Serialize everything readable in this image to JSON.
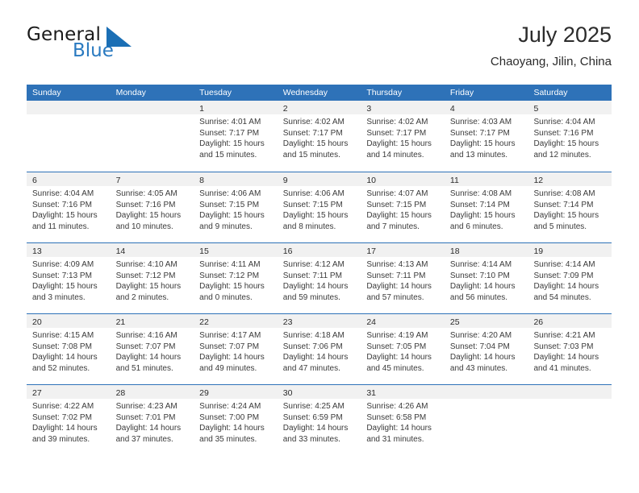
{
  "brand": {
    "word_one": "General",
    "word_two": "Blue",
    "mark": "triangle-logo-icon",
    "accent_color": "#2a7ac0"
  },
  "header": {
    "title": "July 2025",
    "location": "Chaoyang, Jilin, China"
  },
  "theme": {
    "header_blue": "#2e72b8",
    "daynum_band": "#f1f1f1",
    "text": "#3a3a3a"
  },
  "weekdays": [
    "Sunday",
    "Monday",
    "Tuesday",
    "Wednesday",
    "Thursday",
    "Friday",
    "Saturday"
  ],
  "weeks": [
    [
      {
        "day": "",
        "lines": [
          "",
          "",
          "",
          ""
        ]
      },
      {
        "day": "",
        "lines": [
          "",
          "",
          "",
          ""
        ]
      },
      {
        "day": "1",
        "lines": [
          "Sunrise: 4:01 AM",
          "Sunset: 7:17 PM",
          "Daylight: 15 hours",
          "and 15 minutes."
        ]
      },
      {
        "day": "2",
        "lines": [
          "Sunrise: 4:02 AM",
          "Sunset: 7:17 PM",
          "Daylight: 15 hours",
          "and 15 minutes."
        ]
      },
      {
        "day": "3",
        "lines": [
          "Sunrise: 4:02 AM",
          "Sunset: 7:17 PM",
          "Daylight: 15 hours",
          "and 14 minutes."
        ]
      },
      {
        "day": "4",
        "lines": [
          "Sunrise: 4:03 AM",
          "Sunset: 7:17 PM",
          "Daylight: 15 hours",
          "and 13 minutes."
        ]
      },
      {
        "day": "5",
        "lines": [
          "Sunrise: 4:04 AM",
          "Sunset: 7:16 PM",
          "Daylight: 15 hours",
          "and 12 minutes."
        ]
      }
    ],
    [
      {
        "day": "6",
        "lines": [
          "Sunrise: 4:04 AM",
          "Sunset: 7:16 PM",
          "Daylight: 15 hours",
          "and 11 minutes."
        ]
      },
      {
        "day": "7",
        "lines": [
          "Sunrise: 4:05 AM",
          "Sunset: 7:16 PM",
          "Daylight: 15 hours",
          "and 10 minutes."
        ]
      },
      {
        "day": "8",
        "lines": [
          "Sunrise: 4:06 AM",
          "Sunset: 7:15 PM",
          "Daylight: 15 hours",
          "and 9 minutes."
        ]
      },
      {
        "day": "9",
        "lines": [
          "Sunrise: 4:06 AM",
          "Sunset: 7:15 PM",
          "Daylight: 15 hours",
          "and 8 minutes."
        ]
      },
      {
        "day": "10",
        "lines": [
          "Sunrise: 4:07 AM",
          "Sunset: 7:15 PM",
          "Daylight: 15 hours",
          "and 7 minutes."
        ]
      },
      {
        "day": "11",
        "lines": [
          "Sunrise: 4:08 AM",
          "Sunset: 7:14 PM",
          "Daylight: 15 hours",
          "and 6 minutes."
        ]
      },
      {
        "day": "12",
        "lines": [
          "Sunrise: 4:08 AM",
          "Sunset: 7:14 PM",
          "Daylight: 15 hours",
          "and 5 minutes."
        ]
      }
    ],
    [
      {
        "day": "13",
        "lines": [
          "Sunrise: 4:09 AM",
          "Sunset: 7:13 PM",
          "Daylight: 15 hours",
          "and 3 minutes."
        ]
      },
      {
        "day": "14",
        "lines": [
          "Sunrise: 4:10 AM",
          "Sunset: 7:12 PM",
          "Daylight: 15 hours",
          "and 2 minutes."
        ]
      },
      {
        "day": "15",
        "lines": [
          "Sunrise: 4:11 AM",
          "Sunset: 7:12 PM",
          "Daylight: 15 hours",
          "and 0 minutes."
        ]
      },
      {
        "day": "16",
        "lines": [
          "Sunrise: 4:12 AM",
          "Sunset: 7:11 PM",
          "Daylight: 14 hours",
          "and 59 minutes."
        ]
      },
      {
        "day": "17",
        "lines": [
          "Sunrise: 4:13 AM",
          "Sunset: 7:11 PM",
          "Daylight: 14 hours",
          "and 57 minutes."
        ]
      },
      {
        "day": "18",
        "lines": [
          "Sunrise: 4:14 AM",
          "Sunset: 7:10 PM",
          "Daylight: 14 hours",
          "and 56 minutes."
        ]
      },
      {
        "day": "19",
        "lines": [
          "Sunrise: 4:14 AM",
          "Sunset: 7:09 PM",
          "Daylight: 14 hours",
          "and 54 minutes."
        ]
      }
    ],
    [
      {
        "day": "20",
        "lines": [
          "Sunrise: 4:15 AM",
          "Sunset: 7:08 PM",
          "Daylight: 14 hours",
          "and 52 minutes."
        ]
      },
      {
        "day": "21",
        "lines": [
          "Sunrise: 4:16 AM",
          "Sunset: 7:07 PM",
          "Daylight: 14 hours",
          "and 51 minutes."
        ]
      },
      {
        "day": "22",
        "lines": [
          "Sunrise: 4:17 AM",
          "Sunset: 7:07 PM",
          "Daylight: 14 hours",
          "and 49 minutes."
        ]
      },
      {
        "day": "23",
        "lines": [
          "Sunrise: 4:18 AM",
          "Sunset: 7:06 PM",
          "Daylight: 14 hours",
          "and 47 minutes."
        ]
      },
      {
        "day": "24",
        "lines": [
          "Sunrise: 4:19 AM",
          "Sunset: 7:05 PM",
          "Daylight: 14 hours",
          "and 45 minutes."
        ]
      },
      {
        "day": "25",
        "lines": [
          "Sunrise: 4:20 AM",
          "Sunset: 7:04 PM",
          "Daylight: 14 hours",
          "and 43 minutes."
        ]
      },
      {
        "day": "26",
        "lines": [
          "Sunrise: 4:21 AM",
          "Sunset: 7:03 PM",
          "Daylight: 14 hours",
          "and 41 minutes."
        ]
      }
    ],
    [
      {
        "day": "27",
        "lines": [
          "Sunrise: 4:22 AM",
          "Sunset: 7:02 PM",
          "Daylight: 14 hours",
          "and 39 minutes."
        ]
      },
      {
        "day": "28",
        "lines": [
          "Sunrise: 4:23 AM",
          "Sunset: 7:01 PM",
          "Daylight: 14 hours",
          "and 37 minutes."
        ]
      },
      {
        "day": "29",
        "lines": [
          "Sunrise: 4:24 AM",
          "Sunset: 7:00 PM",
          "Daylight: 14 hours",
          "and 35 minutes."
        ]
      },
      {
        "day": "30",
        "lines": [
          "Sunrise: 4:25 AM",
          "Sunset: 6:59 PM",
          "Daylight: 14 hours",
          "and 33 minutes."
        ]
      },
      {
        "day": "31",
        "lines": [
          "Sunrise: 4:26 AM",
          "Sunset: 6:58 PM",
          "Daylight: 14 hours",
          "and 31 minutes."
        ]
      },
      {
        "day": "",
        "lines": [
          "",
          "",
          "",
          ""
        ]
      },
      {
        "day": "",
        "lines": [
          "",
          "",
          "",
          ""
        ]
      }
    ]
  ]
}
